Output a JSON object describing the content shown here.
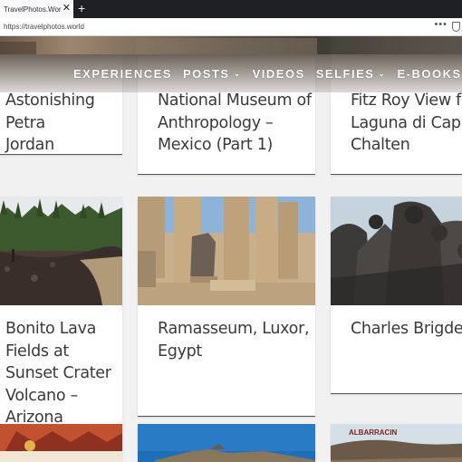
{
  "browser": {
    "tab_title": "TravelPhotos.World - Virtual Tra",
    "tab_close": "✕",
    "new_tab": "+",
    "url": "https://travelphotos.world",
    "menu_dots": "•••"
  },
  "nav": {
    "items": [
      {
        "label": "EXPERIENCES",
        "has_dropdown": false
      },
      {
        "label": "POSTS",
        "has_dropdown": true
      },
      {
        "label": "VIDEOS",
        "has_dropdown": false
      },
      {
        "label": "SELFIES",
        "has_dropdown": true
      },
      {
        "label": "E-BOOKS",
        "has_dropdown": true
      }
    ],
    "chevron": "⌄"
  },
  "posts": [
    {
      "title_lines": [
        "Astonishing Petra",
        "Jordan"
      ]
    },
    {
      "title_lines": [
        "National Museum of",
        "Anthropology –",
        "Mexico (Part 1)"
      ]
    },
    {
      "title_lines": [
        "Fitz Roy View from",
        "Laguna di Capri –",
        "Chalten"
      ]
    },
    {
      "title_lines": [
        "Bonito Lava Fields at",
        "Sunset Crater",
        "Volcano – Arizona"
      ]
    },
    {
      "title_lines": [
        "Ramasseum, Luxor,",
        "Egypt"
      ]
    },
    {
      "title_lines": [
        "Charles Brigde"
      ]
    }
  ],
  "thumb_text": {
    "albarracin": "ALBARRACIN"
  }
}
